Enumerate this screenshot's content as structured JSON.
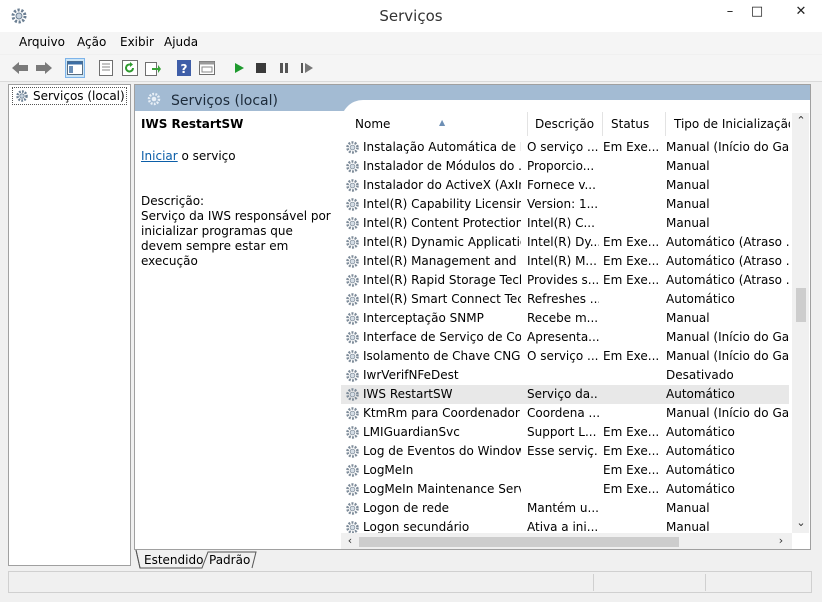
{
  "window": {
    "title": "Serviços",
    "minimize": "–",
    "maximize": "□",
    "close": "✕"
  },
  "menu": [
    "Arquivo",
    "Ação",
    "Exibir",
    "Ajuda"
  ],
  "tree": {
    "root_label": "Serviços (local)"
  },
  "header": {
    "title": "Serviços (local)"
  },
  "detail": {
    "service_name": "IWS RestartSW",
    "start_link": "Iniciar",
    "start_suffix": " o serviço",
    "description_label": "Descrição:",
    "description_text": "Serviço da IWS responsável por inicializar programas que devem sempre estar em execução"
  },
  "columns": [
    "Nome",
    "Descrição",
    "Status",
    "Tipo de Inicialização"
  ],
  "rows": [
    {
      "name": "Instalação Automática de D...",
      "desc": "O serviço ...",
      "status": "Em Exe...",
      "startup": "Manual (Início do Ga..."
    },
    {
      "name": "Instalador de Módulos do ...",
      "desc": "Proporcio...",
      "status": "",
      "startup": "Manual"
    },
    {
      "name": "Instalador do ActiveX (AxIns...",
      "desc": "Fornece v...",
      "status": "",
      "startup": "Manual"
    },
    {
      "name": "Intel(R) Capability Licensing...",
      "desc": "Version: 1....",
      "status": "",
      "startup": "Manual"
    },
    {
      "name": "Intel(R) Content Protection ...",
      "desc": "Intel(R) C...",
      "status": "",
      "startup": "Manual"
    },
    {
      "name": "Intel(R) Dynamic Applicatio...",
      "desc": "Intel(R) Dy...",
      "status": "Em Exe...",
      "startup": "Automático (Atraso ..."
    },
    {
      "name": "Intel(R) Management and S...",
      "desc": "Intel(R) M...",
      "status": "Em Exe...",
      "startup": "Automático (Atraso ..."
    },
    {
      "name": "Intel(R) Rapid Storage Tech...",
      "desc": "Provides s...",
      "status": "Em Exe...",
      "startup": "Automático (Atraso ..."
    },
    {
      "name": "Intel(R) Smart Connect Tec...",
      "desc": "Refreshes ...",
      "status": "",
      "startup": "Automático"
    },
    {
      "name": "Interceptação SNMP",
      "desc": "Recebe m...",
      "status": "",
      "startup": "Manual"
    },
    {
      "name": "Interface de Serviço de Con...",
      "desc": "Apresenta...",
      "status": "",
      "startup": "Manual (Início do Ga..."
    },
    {
      "name": "Isolamento de Chave CNG",
      "desc": "O serviço ...",
      "status": "Em Exe...",
      "startup": "Manual (Início do Ga..."
    },
    {
      "name": "IwrVerifNFeDest",
      "desc": "",
      "status": "",
      "startup": "Desativado"
    },
    {
      "name": "IWS RestartSW",
      "desc": "Serviço da...",
      "status": "",
      "startup": "Automático"
    },
    {
      "name": "KtmRm para Coordenador ...",
      "desc": "Coordena ...",
      "status": "",
      "startup": "Manual (Início do Ga..."
    },
    {
      "name": "LMIGuardianSvc",
      "desc": "Support L...",
      "status": "Em Exe...",
      "startup": "Automático"
    },
    {
      "name": "Log de Eventos do Windows",
      "desc": "Esse serviç...",
      "status": "Em Exe...",
      "startup": "Automático"
    },
    {
      "name": "LogMeIn",
      "desc": "",
      "status": "Em Exe...",
      "startup": "Automático"
    },
    {
      "name": "LogMeIn Maintenance Servi...",
      "desc": "",
      "status": "Em Exe...",
      "startup": "Automático"
    },
    {
      "name": "Logon de rede",
      "desc": "Mantém u...",
      "status": "",
      "startup": "Manual"
    },
    {
      "name": "Logon secundário",
      "desc": "Ativa a ini...",
      "status": "",
      "startup": "Manual"
    }
  ],
  "selected_row": 13,
  "tabs": [
    "Estendido",
    "Padrão"
  ]
}
